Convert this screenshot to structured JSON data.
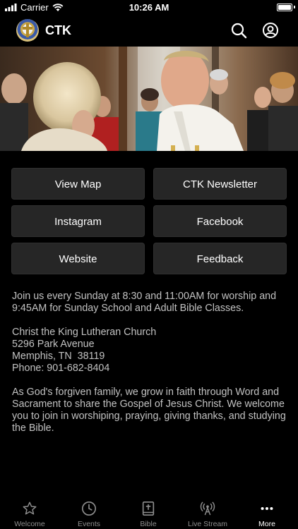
{
  "status_bar": {
    "carrier": "Carrier",
    "time": "10:26 AM",
    "battery_level": 1.0
  },
  "header": {
    "title": "CTK",
    "logo_icon": "church-logo-icon",
    "search_icon": "search-icon",
    "account_icon": "account-icon"
  },
  "hero": {
    "image_description_icon": "hero-photo"
  },
  "buttons": {
    "view_map": "View Map",
    "newsletter": "CTK Newsletter",
    "instagram": "Instagram",
    "facebook": "Facebook",
    "website": "Website",
    "feedback": "Feedback"
  },
  "content": {
    "schedule": "Join us every Sunday at 8:30 and 11:00AM for worship and 9:45AM for Sunday School and Adult Bible Classes.",
    "church_name": "Christ the King Lutheran Church",
    "address_line1": "5296 Park Avenue",
    "address_line2": "Memphis, TN  38119",
    "phone": "Phone: 901-682-8404",
    "mission": "As God's forgiven family, we grow in faith through Word and Sacrament to share the Gospel of Jesus Christ. We welcome you to join in worshiping, praying, giving thanks, and studying the Bible."
  },
  "tabs": [
    {
      "label": "Welcome",
      "icon": "star-icon",
      "active": false
    },
    {
      "label": "Events",
      "icon": "clock-icon",
      "active": false
    },
    {
      "label": "Bible",
      "icon": "bible-icon",
      "active": false
    },
    {
      "label": "Live Stream",
      "icon": "broadcast-icon",
      "active": false
    },
    {
      "label": "More",
      "icon": "more-icon",
      "active": true
    }
  ],
  "colors": {
    "background": "#000000",
    "button_bg": "#262626",
    "text_muted": "#c2c2c2",
    "tab_inactive": "#8e8e8e",
    "tab_active": "#ffffff"
  }
}
